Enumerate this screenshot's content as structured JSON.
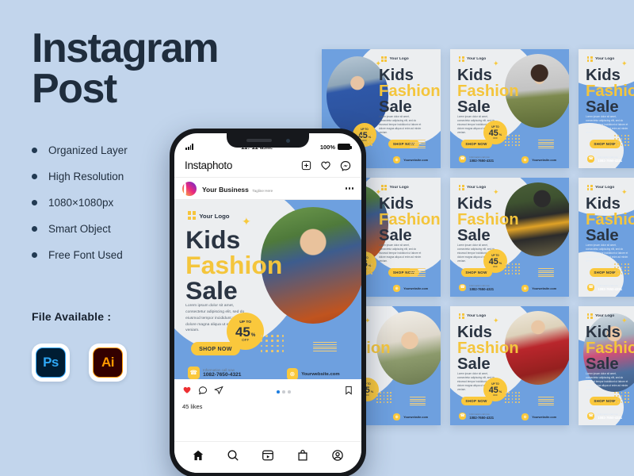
{
  "page_title": {
    "line1": "Instagram",
    "line2": "Post"
  },
  "features": [
    {
      "label": "Organized Layer"
    },
    {
      "label": "High Resolution"
    },
    {
      "label": "1080×1080px"
    },
    {
      "label": "Smart Object"
    },
    {
      "label": "Free Font Used"
    }
  ],
  "file_available": {
    "title": "File Available :",
    "apps": [
      {
        "name": "photoshop-icon",
        "label": "Ps"
      },
      {
        "name": "illustrator-icon",
        "label": "Ai"
      }
    ]
  },
  "phone": {
    "status_bar": {
      "signal": "signal-bars-icon",
      "time": "11: 11 a.m.",
      "battery_percent": "100%"
    },
    "app_bar": {
      "app_name": "Instaphoto",
      "icons": [
        "add-post-icon",
        "heart-icon",
        "messenger-icon"
      ]
    },
    "post_header": {
      "business_name": "Your Business",
      "tagline": "Tagline Here",
      "more_label": "•••"
    },
    "post_actions": {
      "likes": "45 likes",
      "icons": [
        "heart-filled-icon",
        "comment-icon",
        "share-icon",
        "bookmark-icon"
      ],
      "pagination_count": 3,
      "pagination_active": 0
    },
    "bottom_nav": [
      "home-icon",
      "search-icon",
      "reels-icon",
      "shop-icon",
      "profile-icon"
    ]
  },
  "poster": {
    "logo": "Your Logo",
    "headline": {
      "line1": "Kids",
      "line2": "Fashion",
      "line3": "Sale"
    },
    "body": "Lorem ipsum dolor sit amet, consectetur adipiscing elit, sed do eiusmod tempor incididunt ut labore et dolore magna aliqua ut enim ad minim veniam.",
    "badge": {
      "up_to": "UP TO",
      "number": "45",
      "percent": "%",
      "off": "OFF"
    },
    "cta": "SHOP NOW",
    "contact": {
      "label": "Information call now",
      "number": "1082-7650-4321"
    },
    "website": "Yourwebsite.com"
  },
  "thumbnails": [
    {
      "name": "thumb-photo-left",
      "layout": "photo-left",
      "photo": "boy-camera-blue"
    },
    {
      "name": "thumb-photo-right",
      "layout": "photo-right",
      "photo": "boy-stool-green"
    },
    {
      "name": "thumb-blue-no-photo-1",
      "layout": "text-full",
      "photo": "none"
    },
    {
      "name": "thumb-photo-circle",
      "layout": "photo-left",
      "photo": "boy-bowtie"
    },
    {
      "name": "thumb-photo-right-2",
      "layout": "photo-right",
      "photo": "boy-scooter"
    },
    {
      "name": "thumb-blue-no-photo-2",
      "layout": "text-full",
      "photo": "none"
    },
    {
      "name": "thumb-photo-girl-hat",
      "layout": "photo-right",
      "photo": "girl-white-hat"
    },
    {
      "name": "thumb-photo-girl-red",
      "layout": "photo-right",
      "photo": "girl-red-dress"
    },
    {
      "name": "thumb-blue-no-photo-3",
      "layout": "text-full",
      "photo": "girl-floral"
    }
  ],
  "colors": {
    "background": "#c2d5ec",
    "poster_blue": "#6ea0df",
    "poster_yellow": "#fac83c",
    "poster_dark": "#2a3442",
    "poster_light": "#eceef0",
    "title_dark": "#1f2d3d"
  }
}
